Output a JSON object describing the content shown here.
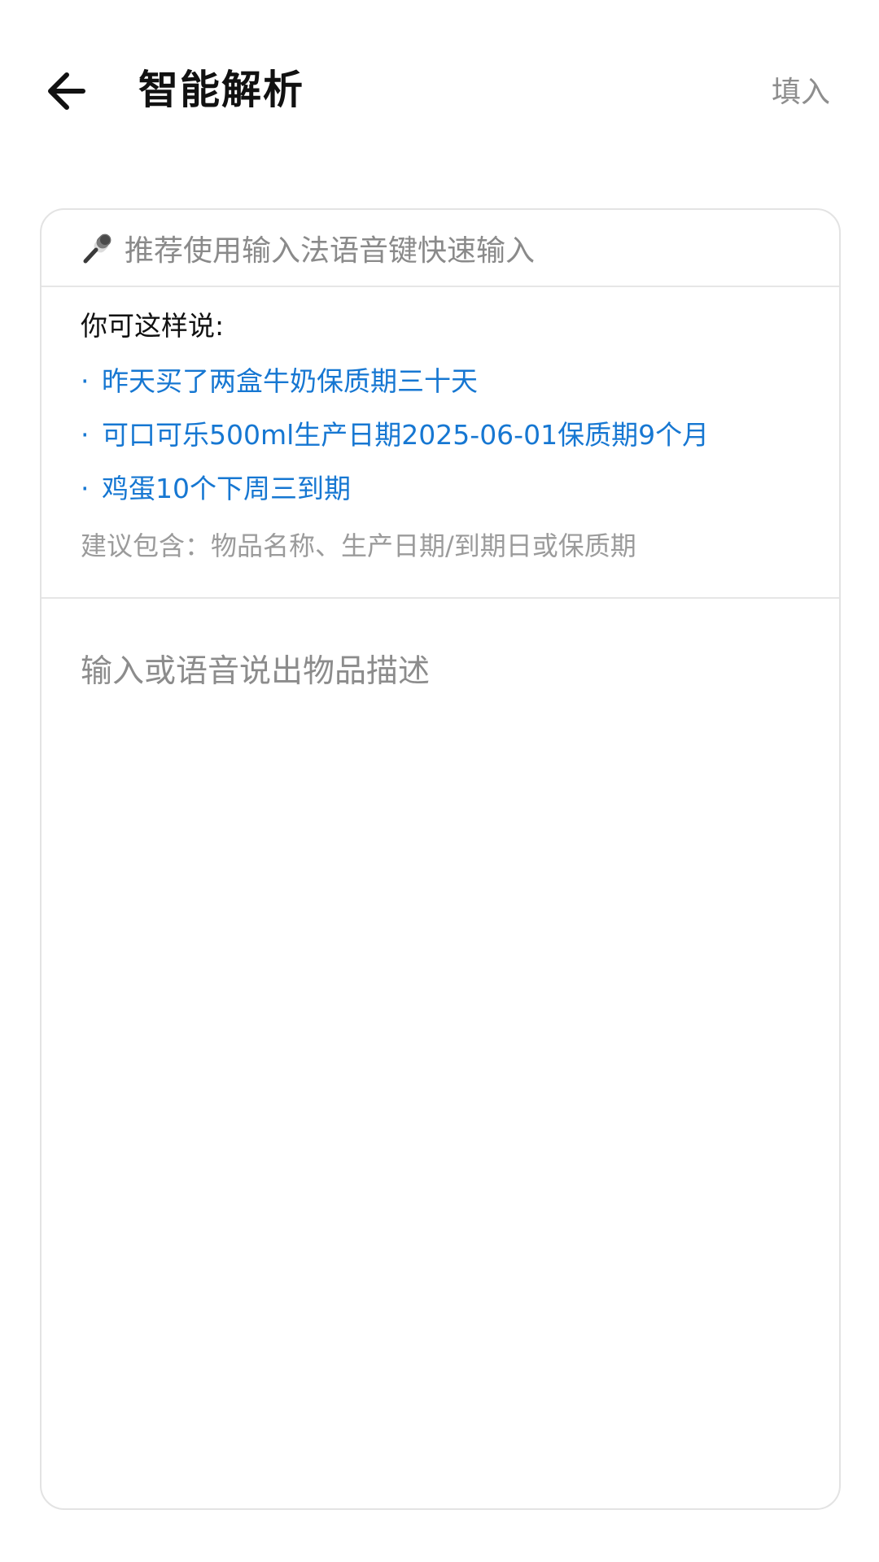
{
  "header": {
    "title": "智能解析",
    "fill_label": "填入"
  },
  "card": {
    "voice_tip": "推荐使用输入法语音键快速输入",
    "examples_heading": "你可这样说:",
    "examples": [
      "昨天买了两盒牛奶保质期三十天",
      "可口可乐500ml生产日期2025-06-01保质期9个月",
      "鸡蛋10个下周三到期"
    ],
    "bullet": "·",
    "suggestion": "建议包含：物品名称、生产日期/到期日或保质期",
    "input": {
      "placeholder": "输入或语音说出物品描述",
      "value": ""
    }
  },
  "colors": {
    "accent": "#1677d2",
    "muted": "#8e8e8e",
    "border": "#e3e3e3"
  },
  "icons": {
    "back": "arrow-left-icon",
    "mic": "microphone-icon"
  }
}
